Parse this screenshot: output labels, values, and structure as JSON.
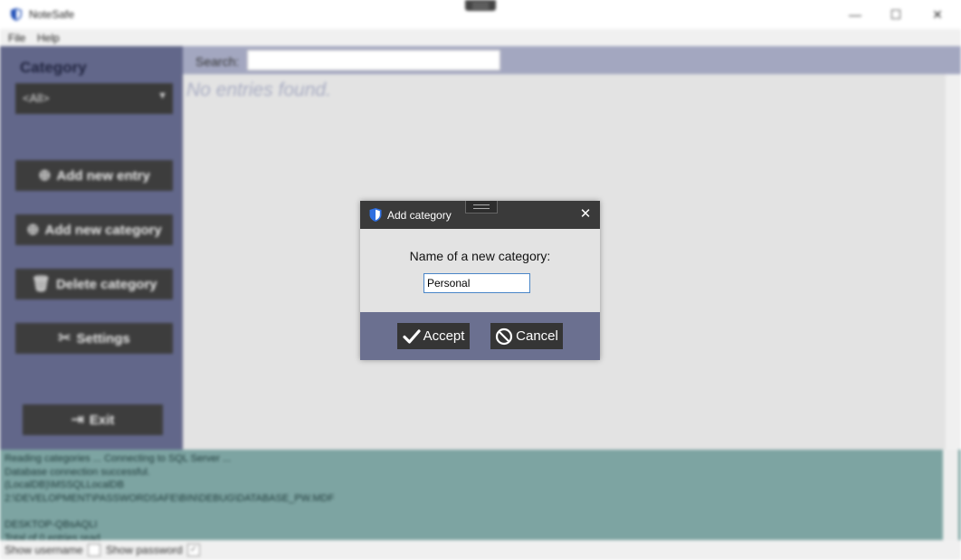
{
  "window": {
    "title": "NoteSafe",
    "controls": {
      "minimize": "—",
      "maximize": "☐",
      "close": "✕"
    }
  },
  "menu": {
    "items": [
      "File",
      "Help"
    ]
  },
  "sidebar": {
    "category_label": "Category",
    "category_selected": "<All>",
    "buttons": [
      {
        "label": "Add new entry",
        "icon": "plus-circle-icon"
      },
      {
        "label": "Add new category",
        "icon": "plus-circle-icon"
      },
      {
        "label": "Delete category",
        "icon": "trash-icon"
      },
      {
        "label": "Settings",
        "icon": "tools-icon"
      }
    ],
    "exit_label": "Exit"
  },
  "search": {
    "label": "Search:",
    "value": ""
  },
  "entries": {
    "empty_message": "No entries found."
  },
  "log": {
    "lines": [
      "Reading categories ... Connecting to SQL Server ...",
      "Database connection successful.",
      "(LocalDB)\\MSSQLLocalDB",
      "2:\\DEVELOPMENT\\PASSWORDSAFE\\BIN\\DEBUG\\DATABASE_PW.MDF",
      "",
      "DESKTOP-QBsAQLI",
      "Total of 0 entries read."
    ]
  },
  "statusbar": {
    "show_username": "Show username",
    "show_password": "Show password"
  },
  "dialog": {
    "title": "Add category",
    "prompt": "Name of a new category:",
    "input_value": "Personal",
    "accept_label": "Accept",
    "cancel_label": "Cancel"
  },
  "colors": {
    "sidebar": "#62678a",
    "footer": "#6b7090",
    "log_background": "#7da4a2",
    "button_dark": "#353535",
    "input_focus": "#4a86c8"
  }
}
